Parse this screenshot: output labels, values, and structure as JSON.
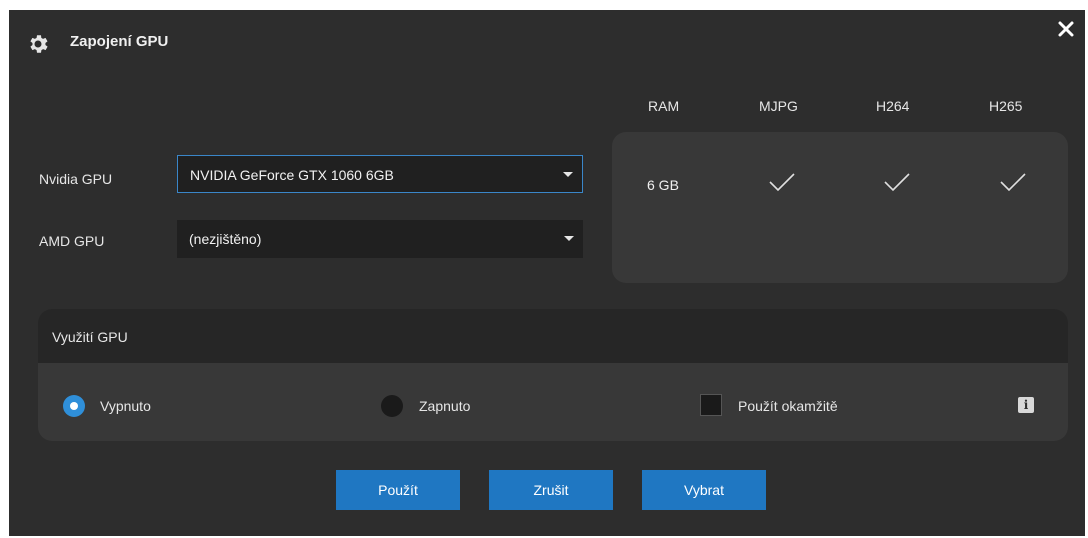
{
  "dialog": {
    "title": "Zapojení GPU",
    "icon": "gear-icon",
    "close_icon": "close-icon"
  },
  "columns": {
    "ram": "RAM",
    "mjpg": "MJPG",
    "h264": "H264",
    "h265": "H265"
  },
  "gpus": {
    "nvidia_label": "Nvidia GPU",
    "nvidia_value": "NVIDIA GeForce GTX 1060 6GB",
    "amd_label": "AMD GPU",
    "amd_value": "(nezjištěno)"
  },
  "capabilities": {
    "ram": "6 GB",
    "mjpg": true,
    "h264": true,
    "h265": true
  },
  "usage": {
    "title": "Využití GPU",
    "off_label": "Vypnuto",
    "on_label": "Zapnuto",
    "selected": "Vypnuto",
    "apply_now_label": "Použít okamžitě",
    "apply_now_checked": false,
    "info_icon": "info-icon"
  },
  "buttons": {
    "apply": "Použít",
    "cancel": "Zrušit",
    "select": "Vybrat"
  },
  "colors": {
    "background": "#2d2d2d",
    "panel": "#383838",
    "accent": "#1f77c2"
  }
}
